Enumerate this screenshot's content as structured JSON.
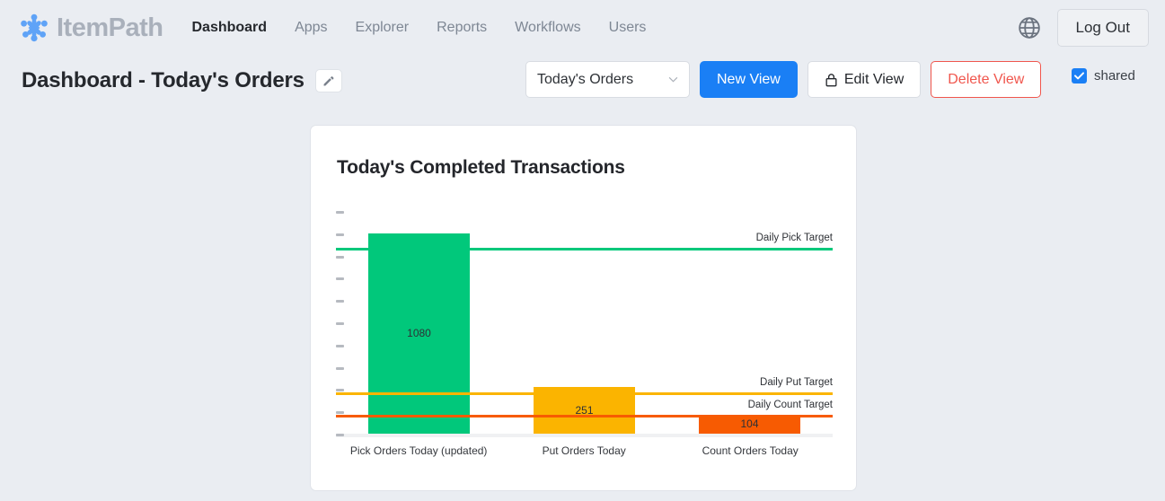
{
  "brand": {
    "name": "ItemPath",
    "logo_icon": "itempath-molecule-logo"
  },
  "nav": {
    "items": [
      {
        "label": "Dashboard",
        "active": true
      },
      {
        "label": "Apps",
        "active": false
      },
      {
        "label": "Explorer",
        "active": false
      },
      {
        "label": "Reports",
        "active": false
      },
      {
        "label": "Workflows",
        "active": false
      },
      {
        "label": "Users",
        "active": false
      }
    ]
  },
  "topright": {
    "language_icon": "globe-icon",
    "logout_label": "Log Out"
  },
  "page": {
    "title": "Dashboard - Today's Orders",
    "edit_title_icon": "pencil-icon"
  },
  "toolbar": {
    "view_select_value": "Today's Orders",
    "view_select_icon": "chevron-down-icon",
    "new_view_label": "New View",
    "edit_view_label": "Edit View",
    "edit_view_icon": "lock-icon",
    "delete_view_label": "Delete View",
    "shared_label": "shared",
    "shared_checked": true,
    "shared_check_icon": "check-icon"
  },
  "colors": {
    "accent_blue": "#1a7ff5",
    "danger_red": "#f0564d",
    "pick_green": "#01c87b",
    "put_amber": "#fbb400",
    "count_orange": "#f75b02",
    "page_bg": "#eaedf2",
    "card_bg": "#ffffff"
  },
  "chart_data": {
    "type": "bar",
    "title": "Today's Completed Transactions",
    "xlabel": "",
    "ylabel": "",
    "grid": false,
    "legend": "none",
    "y_tick_labels": [],
    "y_tick_count": 11,
    "ylim": [
      0,
      1200
    ],
    "categories": [
      "Pick Orders Today (updated)",
      "Put Orders Today",
      "Count Orders Today"
    ],
    "values": [
      1080,
      251,
      104
    ],
    "bar_colors": [
      "#01c87b",
      "#fbb400",
      "#f75b02"
    ],
    "targets": [
      {
        "label": "Daily Pick Target",
        "value": 1000,
        "color": "#01c87b"
      },
      {
        "label": "Daily Put Target",
        "value": 225,
        "color": "#fbb400"
      },
      {
        "label": "Daily Count Target",
        "value": 100,
        "color": "#f75b02"
      }
    ]
  }
}
